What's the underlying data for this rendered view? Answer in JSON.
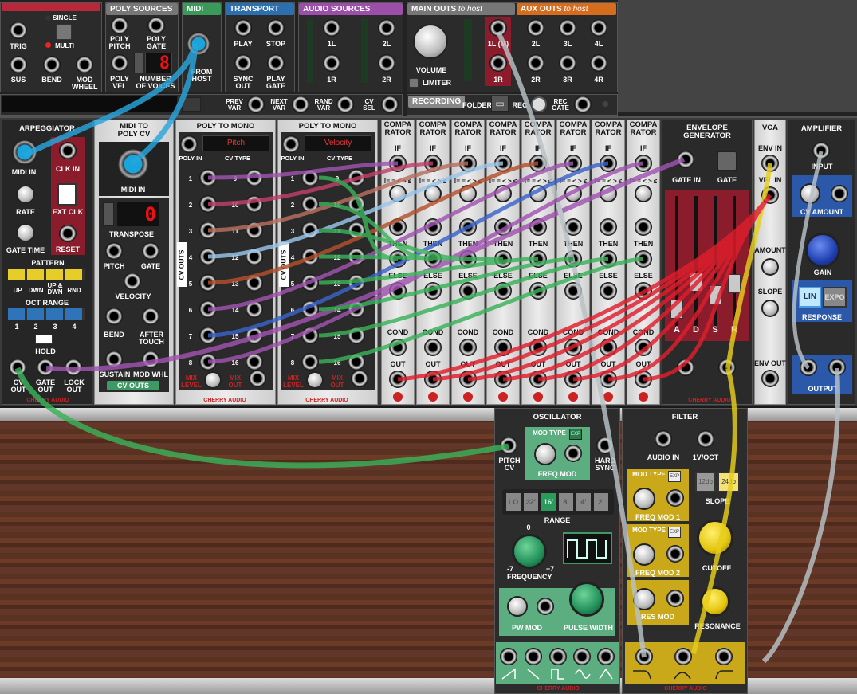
{
  "top": {
    "trig": "TRIG",
    "single": "SINGLE",
    "multi": "MULTI",
    "sus": "SUS",
    "bend": "BEND",
    "mod_wheel": "MOD WHEEL",
    "poly_sources": "POLY SOURCES",
    "poly_pitch": "POLY PITCH",
    "poly_gate": "POLY GATE",
    "poly_vel": "POLY VEL",
    "num_voices": "NUMBER OF VOICES",
    "voices_value": "8",
    "midi": "MIDI",
    "from_host": "FROM HOST",
    "transport": "TRANSPORT",
    "play": "PLAY",
    "stop": "STOP",
    "sync_out": "SYNC OUT",
    "play_gate": "PLAY GATE",
    "audio_sources": "AUDIO SOURCES",
    "l1": "1L",
    "l2": "2L",
    "r1": "1R",
    "r2": "2R",
    "main_outs": "MAIN OUTS",
    "main_outs_to": "to host",
    "volume": "VOLUME",
    "limiter": "LIMITER",
    "aux_outs": "AUX OUTS",
    "aux_outs_to": "to host",
    "m1l": "1L (M)",
    "m1r": "1R",
    "a2l": "2L",
    "a3l": "3L",
    "a4l": "4L",
    "a2r": "2R",
    "a3r": "3R",
    "a4r": "4R",
    "prev_var": "PREV VAR",
    "next_var": "NEXT VAR",
    "rand_var": "RAND VAR",
    "cv_sel": "CV SEL",
    "recording": "RECORDING",
    "folder": "FOLDER",
    "rec": "REC",
    "rec_gate": "REC GATE"
  },
  "arp": {
    "title": "ARPEGGIATOR",
    "midi_in": "MIDI IN",
    "rate": "RATE",
    "gate_time": "GATE TIME",
    "clk_in": "CLK IN",
    "ext_clk": "EXT CLK",
    "reset": "RESET",
    "pattern": "PATTERN",
    "up": "UP",
    "dwn": "DWN",
    "updwn": "UP & DWN",
    "rnd": "RND",
    "oct_range": "OCT RANGE",
    "o1": "1",
    "o2": "2",
    "o3": "3",
    "o4": "4",
    "hold": "HOLD",
    "cv_out": "CV OUT",
    "gate_out": "GATE OUT",
    "lock_out": "LOCK OUT",
    "brand": "CHERRY AUDIO"
  },
  "m2p": {
    "title": "MIDI TO POLY CV",
    "midi_in": "MIDI IN",
    "transpose": "TRANSPOSE",
    "transpose_val": "0",
    "pitch": "PITCH",
    "gate": "GATE",
    "velocity": "VELOCITY",
    "bend": "BEND",
    "aftertouch": "AFTER TOUCH",
    "sustain": "SUSTAIN",
    "modwhl": "MOD WHL",
    "cv_outs": "CV OUTS"
  },
  "p2m1": {
    "title": "POLY TO MONO",
    "display": "Pitch",
    "poly_in": "POLY IN",
    "cv_type": "CV TYPE",
    "cv_outs": "CV OUTS",
    "mix_level": "MIX LEVEL",
    "mix_out": "MIX OUT",
    "brand": "CHERRY AUDIO"
  },
  "p2m2": {
    "title": "POLY TO MONO",
    "display": "Velocity",
    "poly_in": "POLY IN",
    "cv_type": "CV TYPE",
    "cv_outs": "CV OUTS",
    "mix_level": "MIX LEVEL",
    "mix_out": "MIX OUT",
    "brand": "CHERRY AUDIO"
  },
  "nums": [
    "1",
    "2",
    "3",
    "4",
    "5",
    "6",
    "7",
    "8",
    "9",
    "10",
    "11",
    "12",
    "13",
    "14",
    "15",
    "16"
  ],
  "comp": {
    "title": "COMPA RATOR",
    "if": "IF",
    "ops": "!= = < > ≤ ≥",
    "then": "THEN",
    "else": "ELSE",
    "cond": "COND",
    "out": "OUT"
  },
  "env": {
    "title": "ENVELOPE GENERATOR",
    "gate_in": "GATE IN",
    "gate": "GATE",
    "a": "A",
    "d": "D",
    "s": "S",
    "r": "R",
    "brand": "CHERRY AUDIO"
  },
  "vca": {
    "title": "VCA",
    "env_in": "ENV IN",
    "vel_in": "VEL IN",
    "amount": "AMOUNT",
    "slope": "SLOPE",
    "env_out": "ENV OUT"
  },
  "amp": {
    "title": "AMPLIFIER",
    "input": "INPUT",
    "cv_amount": "CV AMOUNT",
    "gain": "GAIN",
    "lin": "LIN",
    "expo": "EXPO",
    "response": "RESPONSE",
    "output": "OUTPUT",
    "brand": "CHERRY AUDIO"
  },
  "osc": {
    "title": "OSCILLATOR",
    "mod_type": "MOD TYPE",
    "exp": "EXP",
    "pitch_cv": "PITCH CV",
    "freq_mod": "FREQ MOD",
    "hard_sync": "HARD SYNC",
    "range": "RANGE",
    "ranges": [
      "LO",
      "32'",
      "16'",
      "8'",
      "4'",
      "2'"
    ],
    "frequency": "FREQUENCY",
    "f0": "0",
    "fm7": "-7",
    "fp7": "+7",
    "pw_mod": "PW MOD",
    "pulse_width": "PULSE WIDTH",
    "brand": "CHERRY AUDIO"
  },
  "filter": {
    "title": "FILTER",
    "audio_in": "AUDIO IN",
    "v_oct": "1V/OCT",
    "mod_type": "MOD TYPE",
    "exp": "EXP",
    "freq_mod1": "FREQ MOD 1",
    "freq_mod2": "FREQ MOD 2",
    "res_mod": "RES MOD",
    "db12": "12db",
    "db24": "24db",
    "slope": "SLOPE",
    "cutoff": "CUTOFF",
    "resonance": "RESONANCE",
    "brand": "CHERRY AUDIO"
  },
  "colors": {
    "accent_red": "#b81d2c",
    "accent_yellow": "#e7cf1c",
    "accent_green": "#3d9a63",
    "accent_blue": "#3b63c9"
  }
}
